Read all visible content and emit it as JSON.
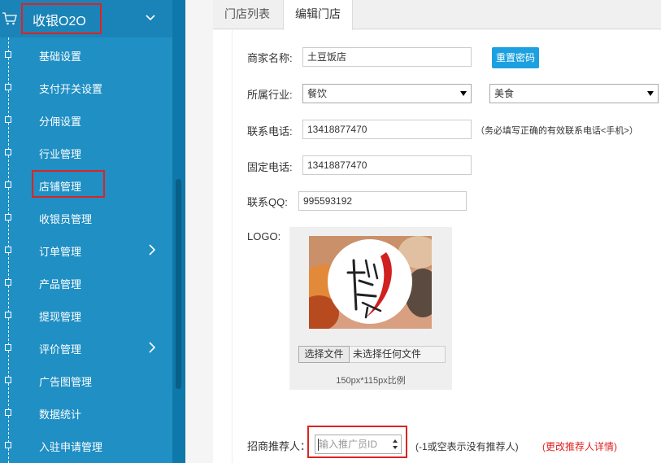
{
  "sidebar": {
    "title": "收银O2O",
    "items": [
      {
        "label": "基础设置"
      },
      {
        "label": "支付开关设置"
      },
      {
        "label": "分佣设置"
      },
      {
        "label": "行业管理"
      },
      {
        "label": "店铺管理"
      },
      {
        "label": "收银员管理"
      },
      {
        "label": "订单管理"
      },
      {
        "label": "产品管理"
      },
      {
        "label": "提现管理"
      },
      {
        "label": "评价管理"
      },
      {
        "label": "广告图管理"
      },
      {
        "label": "数据统计"
      },
      {
        "label": "入驻申请管理"
      }
    ]
  },
  "tabs": [
    {
      "label": "门店列表"
    },
    {
      "label": "编辑门店"
    }
  ],
  "form": {
    "merchant_name_label": "商家名称:",
    "merchant_name_value": "土豆饭店",
    "reset_password_label": "重置密码",
    "industry_label": "所属行业:",
    "industry_primary": "餐饮",
    "industry_secondary": "美食",
    "phone_label": "联系电话:",
    "phone_value": "13418877470",
    "phone_hint": "（务必填写正确的有效联系电话<手机>）",
    "landline_label": "固定电话:",
    "landline_value": "13418877470",
    "qq_label": "联系QQ:",
    "qq_value": "995593192",
    "logo_label": "LOGO:",
    "choose_file_label": "选择文件",
    "no_file_label": "未选择任何文件",
    "logo_size_hint": "150px*115px比例",
    "referrer_label": "招商推荐人：",
    "referrer_placeholder": "输入推广员ID",
    "referrer_hint": "(-1或空表示没有推荐人)",
    "referrer_detail_link": "(更改推荐人详情)"
  },
  "colors": {
    "sidebar": "#1f8fc4",
    "accent_red": "#e02222",
    "button_blue": "#1ca0e0"
  }
}
